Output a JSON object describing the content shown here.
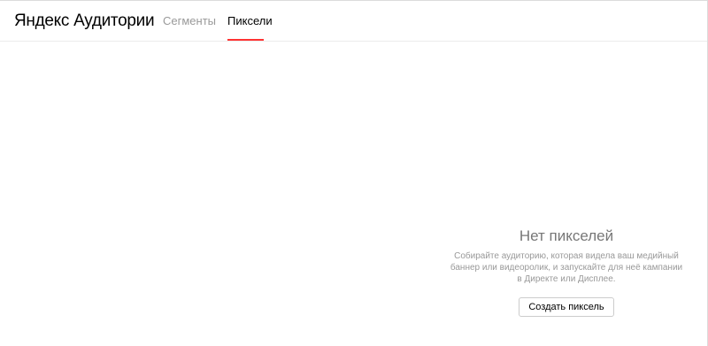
{
  "header": {
    "logo": {
      "brand": "Яндекс",
      "product": "Аудитории"
    },
    "tabs": [
      {
        "label": "Сегменты",
        "active": false
      },
      {
        "label": "Пиксели",
        "active": true
      }
    ],
    "active_tab_color": "#ff3333"
  },
  "empty_state": {
    "title": "Нет пикселей",
    "description": "Собирайте аудиторию, которая видела ваш медийный баннер или видеоролик, и запускайте для неё кампании в Директе или Дисплее.",
    "button_label": "Создать пиксель"
  }
}
